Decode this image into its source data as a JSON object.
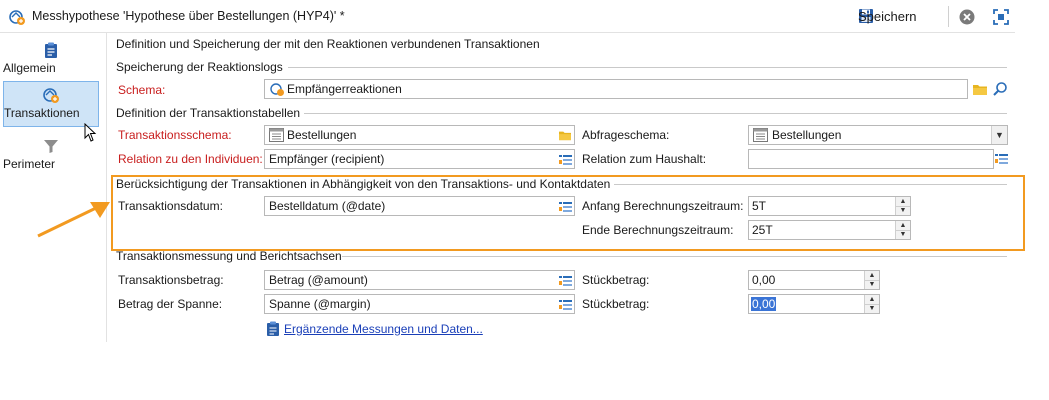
{
  "window": {
    "title": "Messhypothese 'Hypothese über Bestellungen (HYP4)' *",
    "save_label": "Speichern"
  },
  "sidebar": {
    "items": [
      {
        "label": "Allgemein",
        "icon": "clipboard-icon",
        "active": false
      },
      {
        "label": "Transaktionen",
        "icon": "transactions-icon",
        "active": true
      },
      {
        "label": "Perimeter",
        "icon": "filter-icon",
        "active": false
      }
    ]
  },
  "main": {
    "section_title": "Definition und Speicherung der mit den Reaktionen verbundenen Transaktionen",
    "reaction_logs": {
      "title": "Speicherung der Reaktionslogs",
      "schema_label": "Schema:",
      "schema_value": "Empfängerreaktionen"
    },
    "transaction_tables": {
      "title": "Definition der Transaktionstabellen",
      "transaction_schema_label": "Transaktionsschema:",
      "transaction_schema_value": "Bestellungen",
      "query_schema_label": "Abfrageschema:",
      "query_schema_value": "Bestellungen",
      "relation_individuals_label": "Relation zu den Individuen:",
      "relation_individuals_value": "Empfänger (recipient)",
      "relation_household_label": "Relation zum Haushalt:",
      "relation_household_value": ""
    },
    "consideration": {
      "title": "Berücksichtigung der Transaktionen in Abhängigkeit von den Transaktions- und Kontaktdaten",
      "date_label": "Transaktionsdatum:",
      "date_value": "Bestelldatum (@date)",
      "start_label": "Anfang Berechnungszeitraum:",
      "start_value": "5T",
      "end_label": "Ende Berechnungszeitraum:",
      "end_value": "25T"
    },
    "measurement": {
      "title": "Transaktionsmessung und Berichtsachsen",
      "amount_label": "Transaktionsbetrag:",
      "amount_value": "Betrag (@amount)",
      "amount_unit_label": "Stückbetrag:",
      "amount_unit_value": "0,00",
      "margin_label": "Betrag der Spanne:",
      "margin_value": "Spanne (@margin)",
      "margin_unit_label": "Stückbetrag:",
      "margin_unit_value": "0,00",
      "more_link": "Ergänzende Messungen und Daten..."
    }
  },
  "colors": {
    "highlight": "#f29a20",
    "required_label": "#c81e1e",
    "link": "#1a3fb8",
    "active_nav": "#cfe4f7"
  }
}
